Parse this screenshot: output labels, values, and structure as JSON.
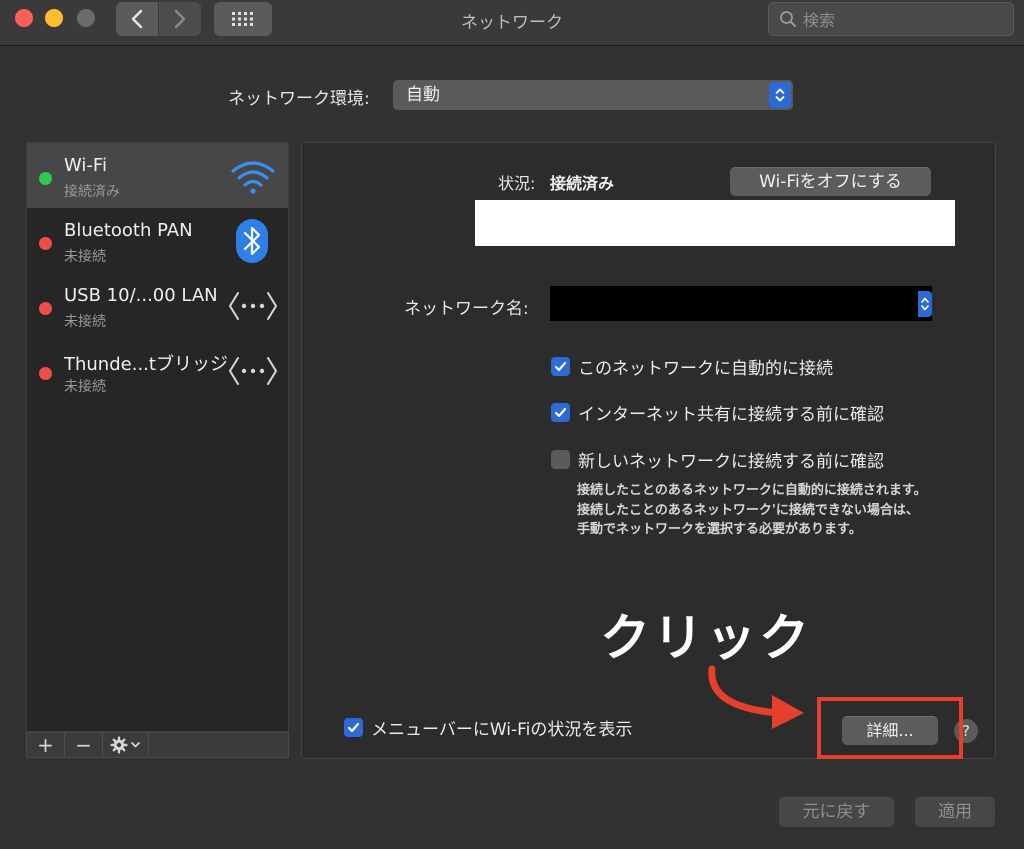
{
  "window": {
    "title": "ネットワーク",
    "search_placeholder": "検索"
  },
  "location": {
    "label": "ネットワーク環境:",
    "value": "自動"
  },
  "services": [
    {
      "name": "Wi-Fi",
      "status": "接続済み",
      "status_color": "#30c94f",
      "icon": "wifi-icon",
      "selected": true
    },
    {
      "name": "Bluetooth PAN",
      "status": "未接続",
      "status_color": "#ee4d4a",
      "icon": "bluetooth-icon"
    },
    {
      "name": "USB 10/...00 LAN",
      "status": "未接続",
      "status_color": "#ee4d4a",
      "icon": "ethernet-icon"
    },
    {
      "name": "Thunde...tブリッジ",
      "status": "未接続",
      "status_color": "#ee4d4a",
      "icon": "ethernet-icon"
    }
  ],
  "sidebar_toolbar": {
    "add": "+",
    "remove": "−"
  },
  "main": {
    "status_label": "状況:",
    "status_value": "接続済み",
    "wifi_off_button": "Wi-Fiをオフにする",
    "network_name_label": "ネットワーク名:",
    "checkbox_auto_join": {
      "label": "このネットワークに自動的に接続",
      "checked": true
    },
    "checkbox_ask_hotspot": {
      "label": "インターネット共有に接続する前に確認",
      "checked": true
    },
    "checkbox_ask_new": {
      "label": "新しいネットワークに接続する前に確認",
      "checked": false
    },
    "hint": "接続したことのあるネットワークに自動的に接続されます。接続したことのあるネットワーク'に接続できない場合は、手動でネットワークを選択する必要があります。",
    "checkbox_menubar": {
      "label": "メニューバーにWi-Fiの状況を表示",
      "checked": true
    },
    "advanced_button": "詳細...",
    "help_button": "?"
  },
  "annotation": {
    "caption": "クリック",
    "color": "#e5402b"
  },
  "footer": {
    "revert_button": "元に戻す",
    "apply_button": "適用"
  },
  "colors": {
    "accent": "#2d6ad6",
    "connected": "#30c94f",
    "disconnected": "#ee4d4a"
  }
}
